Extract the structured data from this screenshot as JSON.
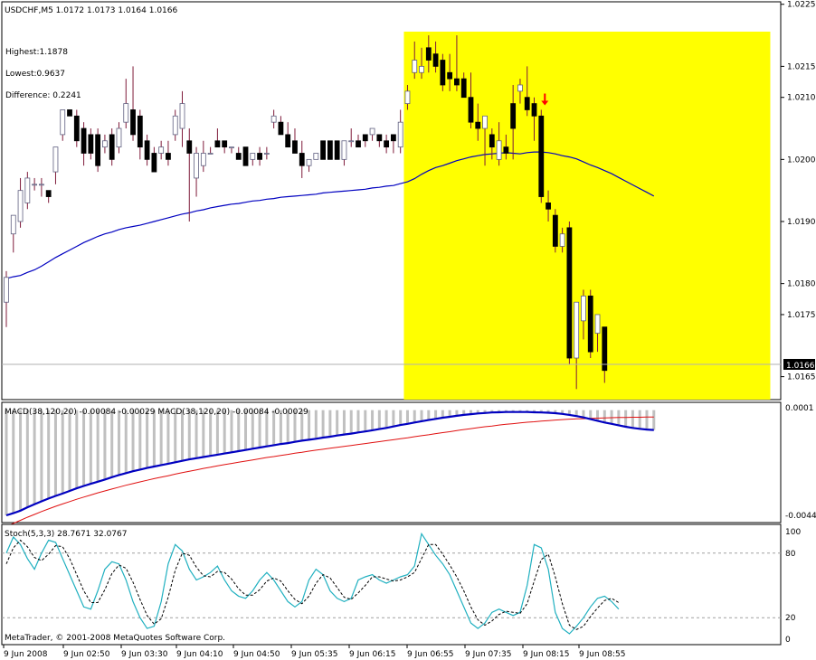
{
  "symbol_header": "USDCHF,M5  1.0172 1.0173 1.0164 1.0166",
  "info": {
    "highest": "Highest:1.1878",
    "lowest": "Lowest:0.9637",
    "difference": "Difference: 0.2241"
  },
  "macd_header": "MACD(38,120,20) -0.00084 -0.00029  MACD(38,120,20) -0.00084 -0.00029",
  "stoch_header": "Stoch(5,3,3) 28.7671 32.0767",
  "copyright": "MetaTrader, © 2001-2008 MetaQuotes Software Corp.",
  "current_price_label": "1.0166",
  "colors": {
    "highlight": "#ffff00",
    "bull_body": "#ffffff",
    "bear_body": "#000000",
    "wick": "#7f1b3a",
    "ma_line": "#0000c0",
    "macd_main": "#0000c0",
    "macd_signal": "#e01010",
    "macd_hist": "#c0c0c0",
    "stoch_main": "#20b0c0",
    "stoch_signal": "#000000",
    "arrow": "#ff0000"
  },
  "chart_data": [
    {
      "type": "candlestick",
      "title": "USDCHF,M5",
      "y_ticks": [
        "1.0225",
        "1.0215",
        "1.0210",
        "1.0200",
        "1.0190",
        "1.0180",
        "1.0175",
        "1.0165"
      ],
      "ylim": [
        1.01613,
        1.02254
      ],
      "x_ticks": [
        "9 Jun 2008",
        "9 Jun 02:50",
        "9 Jun 03:30",
        "9 Jun 04:10",
        "9 Jun 04:50",
        "9 Jun 05:35",
        "9 Jun 06:15",
        "9 Jun 06:55",
        "9 Jun 07:35",
        "9 Jun 08:15",
        "9 Jun 08:55"
      ],
      "highlight_range": [
        57,
        85
      ],
      "signal_arrow_index": 76,
      "candles": [
        [
          1.0177,
          1.0182,
          1.0173,
          1.0181
        ],
        [
          1.0188,
          1.0189,
          1.0185,
          1.0191
        ],
        [
          1.019,
          1.0197,
          1.0189,
          1.0195
        ],
        [
          1.0193,
          1.0198,
          1.0192,
          1.0197
        ],
        [
          1.0196,
          1.0197,
          1.0195,
          1.0196
        ],
        [
          1.0196,
          1.0197,
          1.0194,
          1.0196
        ],
        [
          1.0195,
          1.0195,
          1.0193,
          1.0194
        ],
        [
          1.0198,
          1.0202,
          1.0196,
          1.0202
        ],
        [
          1.0204,
          1.0208,
          1.0203,
          1.0208
        ],
        [
          1.0208,
          1.0208,
          1.0207,
          1.0207
        ],
        [
          1.0207,
          1.0208,
          1.0202,
          1.0203
        ],
        [
          1.0205,
          1.0206,
          1.0199,
          1.0201
        ],
        [
          1.0204,
          1.0205,
          1.02,
          1.0201
        ],
        [
          1.0204,
          1.0205,
          1.0198,
          1.0199
        ],
        [
          1.0202,
          1.0204,
          1.0201,
          1.0203
        ],
        [
          1.0204,
          1.0205,
          1.0199,
          1.02
        ],
        [
          1.0202,
          1.0206,
          1.0201,
          1.0205
        ],
        [
          1.0206,
          1.0213,
          1.0205,
          1.0209
        ],
        [
          1.0208,
          1.0215,
          1.0203,
          1.0204
        ],
        [
          1.0207,
          1.0208,
          1.02,
          1.0202
        ],
        [
          1.0203,
          1.0204,
          1.0199,
          1.02
        ],
        [
          1.0201,
          1.0202,
          1.0198,
          1.0198
        ],
        [
          1.0201,
          1.0203,
          1.02,
          1.0202
        ],
        [
          1.0201,
          1.0203,
          1.0199,
          1.02
        ],
        [
          1.0204,
          1.0208,
          1.0203,
          1.0207
        ],
        [
          1.0205,
          1.0211,
          1.0202,
          1.0209
        ],
        [
          1.0203,
          1.0205,
          1.019,
          1.0201
        ],
        [
          1.0197,
          1.0202,
          1.0194,
          1.0201
        ],
        [
          1.0199,
          1.0203,
          1.0198,
          1.0201
        ],
        [
          1.0201,
          1.0202,
          1.0201,
          1.0201
        ],
        [
          1.0203,
          1.0205,
          1.0202,
          1.0202
        ],
        [
          1.0203,
          1.0203,
          1.0201,
          1.0202
        ],
        [
          1.0202,
          1.0202,
          1.0201,
          1.0202
        ],
        [
          1.0201,
          1.0202,
          1.02,
          1.02
        ],
        [
          1.0202,
          1.0202,
          1.0199,
          1.0199
        ],
        [
          1.02,
          1.0201,
          1.0199,
          1.0201
        ],
        [
          1.0201,
          1.0202,
          1.0199,
          1.02
        ],
        [
          1.0201,
          1.0202,
          1.02,
          1.0201
        ],
        [
          1.0206,
          1.0208,
          1.0205,
          1.0207
        ],
        [
          1.0206,
          1.0207,
          1.0204,
          1.0204
        ],
        [
          1.0204,
          1.0206,
          1.0202,
          1.0202
        ],
        [
          1.0203,
          1.0205,
          1.0201,
          1.0201
        ],
        [
          1.0201,
          1.0203,
          1.0197,
          1.0199
        ],
        [
          1.0199,
          1.02,
          1.0198,
          1.02
        ],
        [
          1.02,
          1.0201,
          1.02,
          1.0201
        ],
        [
          1.0203,
          1.0203,
          1.02,
          1.02
        ],
        [
          1.0203,
          1.0203,
          1.02,
          1.02
        ],
        [
          1.0203,
          1.0203,
          1.02,
          1.02
        ],
        [
          1.02,
          1.0203,
          1.0199,
          1.0203
        ],
        [
          1.0203,
          1.0205,
          1.0202,
          1.0203
        ],
        [
          1.0203,
          1.0204,
          1.0202,
          1.0202
        ],
        [
          1.0204,
          1.0204,
          1.0202,
          1.0203
        ],
        [
          1.0204,
          1.0205,
          1.0203,
          1.0205
        ],
        [
          1.0204,
          1.0204,
          1.0202,
          1.0203
        ],
        [
          1.0203,
          1.0204,
          1.0201,
          1.0202
        ],
        [
          1.0204,
          1.0204,
          1.0201,
          1.0203
        ],
        [
          1.0202,
          1.0208,
          1.0201,
          1.0206
        ],
        [
          1.0209,
          1.0212,
          1.0208,
          1.0211
        ],
        [
          1.0214,
          1.0219,
          1.0213,
          1.0216
        ],
        [
          1.0214,
          1.0218,
          1.0213,
          1.0215
        ],
        [
          1.0218,
          1.022,
          1.0214,
          1.0216
        ],
        [
          1.0217,
          1.0219,
          1.0214,
          1.0215
        ],
        [
          1.0216,
          1.0217,
          1.0211,
          1.0212
        ],
        [
          1.0214,
          1.0217,
          1.0211,
          1.0213
        ],
        [
          1.0213,
          1.022,
          1.0211,
          1.0212
        ],
        [
          1.0213,
          1.0214,
          1.021,
          1.021
        ],
        [
          1.021,
          1.0214,
          1.0205,
          1.0206
        ],
        [
          1.0206,
          1.0209,
          1.0203,
          1.0205
        ],
        [
          1.0205,
          1.0207,
          1.0199,
          1.0207
        ],
        [
          1.0204,
          1.0205,
          1.02,
          1.0202
        ],
        [
          1.02,
          1.0206,
          1.0199,
          1.0203
        ],
        [
          1.0202,
          1.0204,
          1.02,
          1.0201
        ],
        [
          1.0209,
          1.0212,
          1.02,
          1.0205
        ],
        [
          1.0211,
          1.0213,
          1.0209,
          1.0212
        ],
        [
          1.021,
          1.0215,
          1.0207,
          1.0208
        ],
        [
          1.0209,
          1.021,
          1.0203,
          1.0207
        ],
        [
          1.0207,
          1.0208,
          1.0193,
          1.0194
        ],
        [
          1.0193,
          1.0195,
          1.019,
          1.0192
        ],
        [
          1.0191,
          1.0192,
          1.0185,
          1.0186
        ],
        [
          1.0186,
          1.0189,
          1.0185,
          1.0188
        ],
        [
          1.0189,
          1.019,
          1.0167,
          1.0168
        ],
        [
          1.0168,
          1.0176,
          1.0163,
          1.0177
        ],
        [
          1.0174,
          1.0179,
          1.0171,
          1.0178
        ],
        [
          1.0178,
          1.0179,
          1.0168,
          1.0169
        ],
        [
          1.0172,
          1.0175,
          1.0169,
          1.0175
        ],
        [
          1.0173,
          1.0173,
          1.0164,
          1.0166
        ]
      ],
      "ma_values": [
        1.01808,
        1.01811,
        1.01813,
        1.01818,
        1.01822,
        1.01828,
        1.01835,
        1.01842,
        1.01848,
        1.01854,
        1.0186,
        1.01866,
        1.01871,
        1.01876,
        1.0188,
        1.01883,
        1.01887,
        1.0189,
        1.01892,
        1.01894,
        1.01897,
        1.019,
        1.01903,
        1.01906,
        1.01909,
        1.01912,
        1.01914,
        1.01917,
        1.01919,
        1.01922,
        1.01924,
        1.01926,
        1.01928,
        1.01929,
        1.01931,
        1.01933,
        1.01934,
        1.01936,
        1.01937,
        1.01939,
        1.0194,
        1.01941,
        1.01942,
        1.01943,
        1.01944,
        1.01946,
        1.01947,
        1.01948,
        1.01949,
        1.0195,
        1.01951,
        1.01952,
        1.01954,
        1.01955,
        1.01957,
        1.01958,
        1.01961,
        1.01964,
        1.01969,
        1.01976,
        1.01982,
        1.01987,
        1.0199,
        1.01994,
        1.01998,
        1.02001,
        1.02004,
        1.02006,
        1.02008,
        1.02009,
        1.0201,
        1.02011,
        1.0201,
        1.02009,
        1.02011,
        1.02012,
        1.02012,
        1.02011,
        1.02009,
        1.02006,
        1.02004,
        1.02001,
        1.01996,
        1.01991,
        1.01987,
        1.01982,
        1.01977,
        1.01971,
        1.01965,
        1.01959,
        1.01953,
        1.01947,
        1.01941
      ]
    },
    {
      "type": "line",
      "title": "MACD(38,120,20)",
      "y_ticks": [
        "0.0001",
        "-0.00444"
      ],
      "ylim": [
        -0.00444,
        0.0001
      ],
      "series": [
        {
          "name": "MACD",
          "values": [
            -0.00444,
            -0.00435,
            -0.00424,
            -0.0041,
            -0.00397,
            -0.00385,
            -0.00373,
            -0.00362,
            -0.00352,
            -0.00341,
            -0.0033,
            -0.0032,
            -0.00311,
            -0.00302,
            -0.00293,
            -0.00283,
            -0.00274,
            -0.00266,
            -0.00258,
            -0.00251,
            -0.00244,
            -0.00238,
            -0.00232,
            -0.00226,
            -0.0022,
            -0.00214,
            -0.00208,
            -0.00203,
            -0.00198,
            -0.00193,
            -0.00188,
            -0.00183,
            -0.00178,
            -0.00173,
            -0.00168,
            -0.00163,
            -0.00158,
            -0.00153,
            -0.00148,
            -0.00143,
            -0.00139,
            -0.00134,
            -0.00129,
            -0.00125,
            -0.00121,
            -0.00116,
            -0.00112,
            -0.00107,
            -0.00103,
            -0.00099,
            -0.00094,
            -0.0009,
            -0.00085,
            -0.0008,
            -0.00075,
            -0.00069,
            -0.00063,
            -0.00058,
            -0.00052,
            -0.00047,
            -0.00042,
            -0.00037,
            -0.00032,
            -0.00028,
            -0.00024,
            -0.0002,
            -0.00017,
            -0.00014,
            -0.00012,
            -0.0001,
            -9e-05,
            -8e-05,
            -8e-05,
            -8e-05,
            -8e-05,
            -9e-05,
            -0.0001,
            -0.00011,
            -0.00013,
            -0.00016,
            -0.0002,
            -0.00025,
            -0.00031,
            -0.00038,
            -0.00045,
            -0.00052,
            -0.00058,
            -0.00064,
            -0.0007,
            -0.00075,
            -0.00079,
            -0.00082,
            -0.00084
          ]
        },
        {
          "name": "Signal",
          "values": [
            -0.0049,
            -0.00478,
            -0.00465,
            -0.00452,
            -0.0044,
            -0.00428,
            -0.00417,
            -0.00406,
            -0.00396,
            -0.00386,
            -0.00376,
            -0.00367,
            -0.00358,
            -0.00349,
            -0.00341,
            -0.00333,
            -0.00325,
            -0.00317,
            -0.0031,
            -0.00303,
            -0.00296,
            -0.00289,
            -0.00283,
            -0.00277,
            -0.0027,
            -0.00264,
            -0.00258,
            -0.00252,
            -0.00246,
            -0.00241,
            -0.00235,
            -0.0023,
            -0.00225,
            -0.0022,
            -0.00215,
            -0.0021,
            -0.00205,
            -0.002,
            -0.00196,
            -0.00191,
            -0.00187,
            -0.00182,
            -0.00178,
            -0.00173,
            -0.00169,
            -0.00165,
            -0.00161,
            -0.00157,
            -0.00153,
            -0.00149,
            -0.00145,
            -0.00141,
            -0.00137,
            -0.00133,
            -0.00129,
            -0.00125,
            -0.00121,
            -0.00117,
            -0.00112,
            -0.00108,
            -0.00104,
            -0.00099,
            -0.00095,
            -0.00091,
            -0.00086,
            -0.00082,
            -0.00078,
            -0.00074,
            -0.0007,
            -0.00067,
            -0.00063,
            -0.0006,
            -0.00057,
            -0.00054,
            -0.00051,
            -0.00049,
            -0.00046,
            -0.00044,
            -0.00042,
            -0.0004,
            -0.00038,
            -0.00037,
            -0.00036,
            -0.00035,
            -0.00034,
            -0.00033,
            -0.00032,
            -0.00031,
            -0.00031,
            -0.0003,
            -0.0003,
            -0.00029,
            -0.00029
          ]
        }
      ]
    },
    {
      "type": "line",
      "title": "Stoch(5,3,3)",
      "y_ticks": [
        "100",
        "80",
        "20",
        "0"
      ],
      "levels": [
        80,
        20
      ],
      "ylim": [
        0,
        100
      ],
      "series": [
        {
          "name": "Main",
          "values": [
            80,
            95,
            88,
            75,
            65,
            80,
            92,
            90,
            75,
            60,
            45,
            30,
            28,
            45,
            65,
            72,
            70,
            55,
            35,
            20,
            10,
            12,
            35,
            70,
            88,
            82,
            65,
            55,
            58,
            62,
            68,
            55,
            45,
            40,
            38,
            45,
            55,
            62,
            55,
            45,
            35,
            30,
            35,
            55,
            65,
            60,
            45,
            38,
            35,
            38,
            55,
            58,
            60,
            55,
            52,
            55,
            58,
            60,
            68,
            98,
            88,
            78,
            70,
            60,
            45,
            30,
            15,
            10,
            15,
            25,
            28,
            25,
            22,
            25,
            50,
            88,
            85,
            65,
            25,
            10,
            5,
            12,
            20,
            30,
            38,
            40,
            35,
            28
          ]
        },
        {
          "name": "Signal",
          "values": [
            70,
            85,
            92,
            86,
            76,
            73,
            79,
            87,
            86,
            75,
            60,
            45,
            34,
            34,
            46,
            61,
            69,
            66,
            53,
            37,
            22,
            14,
            19,
            39,
            64,
            80,
            78,
            67,
            59,
            58,
            63,
            62,
            56,
            47,
            41,
            41,
            46,
            54,
            57,
            54,
            45,
            37,
            33,
            40,
            52,
            60,
            57,
            48,
            39,
            37,
            43,
            50,
            58,
            58,
            56,
            54,
            55,
            58,
            62,
            75,
            88,
            88,
            79,
            69,
            58,
            45,
            30,
            18,
            13,
            17,
            23,
            26,
            25,
            24,
            33,
            54,
            74,
            79,
            58,
            33,
            13,
            9,
            12,
            21,
            29,
            36,
            38,
            34
          ]
        }
      ]
    }
  ]
}
